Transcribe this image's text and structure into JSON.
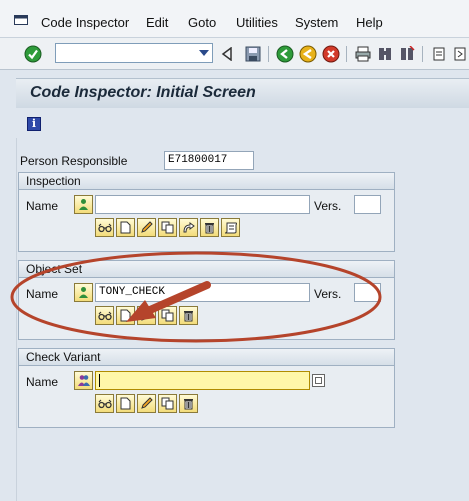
{
  "menu": {
    "items": [
      "Code Inspector",
      "Edit",
      "Goto",
      "Utilities",
      "System",
      "Help"
    ]
  },
  "header": {
    "title": "Code Inspector: Initial Screen"
  },
  "person": {
    "label": "Person Responsible",
    "value": "E71800017"
  },
  "inspection": {
    "title": "Inspection",
    "name_label": "Name",
    "name_value": "",
    "vers_label": "Vers.",
    "vers_value": ""
  },
  "object_set": {
    "title": "Object Set",
    "name_label": "Name",
    "name_value": "TONY_CHECK",
    "vers_label": "Vers.",
    "vers_value": ""
  },
  "check_variant": {
    "title": "Check Variant",
    "name_label": "Name",
    "name_value": ""
  },
  "colors": {
    "annotation": "#b5442b",
    "required_field": "#fff7a8",
    "button_face": "#f3dc7a"
  },
  "icons": {
    "toolbar": [
      "enter-icon",
      "command-dropdown-icon",
      "back-arrow-icon",
      "save-icon",
      "back-icon",
      "exit-icon",
      "cancel-icon",
      "print-icon",
      "find-icon",
      "find-next-icon",
      "first-page-icon"
    ],
    "row_buttons": [
      "display-icon",
      "create-icon",
      "edit-icon",
      "copy-icon",
      "rename-icon",
      "delete-icon",
      "comment-icon"
    ]
  }
}
